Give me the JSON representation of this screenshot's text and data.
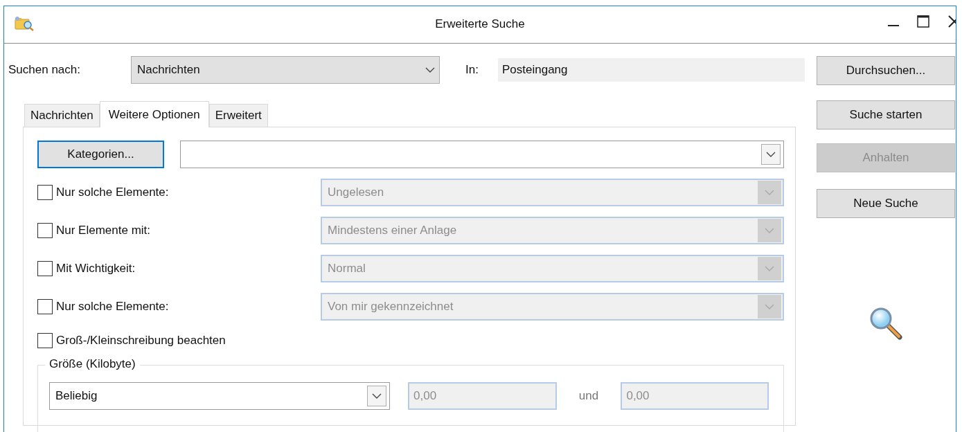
{
  "window": {
    "title": "Erweiterte Suche"
  },
  "search_for": {
    "label": "Suchen nach:",
    "value": "Nachrichten"
  },
  "location": {
    "label": "In:",
    "value": "Posteingang"
  },
  "tabs": [
    {
      "label": "Nachrichten",
      "selected": false
    },
    {
      "label": "Weitere Optionen",
      "selected": true
    },
    {
      "label": "Erweitert",
      "selected": false
    }
  ],
  "categories": {
    "button": "Kategorien...",
    "focused": true
  },
  "filters": [
    {
      "label": "Nur solche Elemente:",
      "checked": false,
      "value": "Ungelesen",
      "disabled": true
    },
    {
      "label": "Nur Elemente mit:",
      "checked": false,
      "value": "Mindestens einer Anlage",
      "disabled": true
    },
    {
      "label": "Mit Wichtigkeit:",
      "checked": false,
      "value": "Normal",
      "disabled": true
    },
    {
      "label": "Nur solche Elemente:",
      "checked": false,
      "value": "Von mir gekennzeichnet",
      "disabled": true
    }
  ],
  "case_sensitive": {
    "label": "Groß-/Kleinschreibung beachten",
    "checked": false
  },
  "size": {
    "title": "Größe (Kilobyte)",
    "condition": "Beliebig",
    "from": "0,00",
    "and_label": "und",
    "to": "0,00",
    "disabled": true
  },
  "buttons": [
    {
      "label": "Durchsuchen...",
      "disabled": false
    },
    {
      "label": "Suche starten",
      "disabled": false
    },
    {
      "label": "Anhalten",
      "disabled": true
    },
    {
      "label": "Neue Suche",
      "disabled": false
    }
  ]
}
